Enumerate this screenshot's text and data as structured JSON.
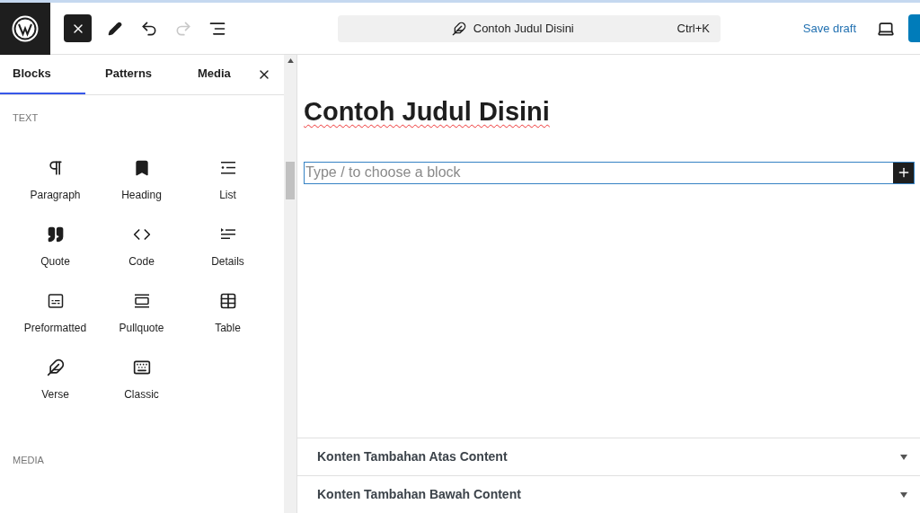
{
  "toolbar": {
    "close_selected": true,
    "document_title": "Contoh Judul Disini",
    "shortcut": "Ctrl+K",
    "save_label": "Save draft",
    "redo_disabled": true
  },
  "inserter": {
    "tabs": [
      {
        "label": "Blocks",
        "selected": true
      },
      {
        "label": "Patterns",
        "selected": false
      },
      {
        "label": "Media",
        "selected": false
      }
    ],
    "sections": [
      {
        "heading": "TEXT",
        "blocks": [
          {
            "label": "Paragraph",
            "kind": "paragraph"
          },
          {
            "label": "Heading",
            "kind": "heading"
          },
          {
            "label": "List",
            "kind": "list"
          },
          {
            "label": "Quote",
            "kind": "quote"
          },
          {
            "label": "Code",
            "kind": "code"
          },
          {
            "label": "Details",
            "kind": "details"
          },
          {
            "label": "Preformatted",
            "kind": "preformatted"
          },
          {
            "label": "Pullquote",
            "kind": "pullquote"
          },
          {
            "label": "Table",
            "kind": "table"
          },
          {
            "label": "Verse",
            "kind": "verse"
          },
          {
            "label": "Classic",
            "kind": "classic"
          }
        ]
      },
      {
        "heading": "MEDIA"
      }
    ]
  },
  "editor": {
    "title": "Contoh Judul Disini",
    "block_placeholder": "Type / to choose a block"
  },
  "meta_boxes": [
    {
      "title": "Konten Tambahan Atas Content",
      "expanded": false
    },
    {
      "title": "Konten Tambahan Bawah Content",
      "expanded": false
    }
  ]
}
